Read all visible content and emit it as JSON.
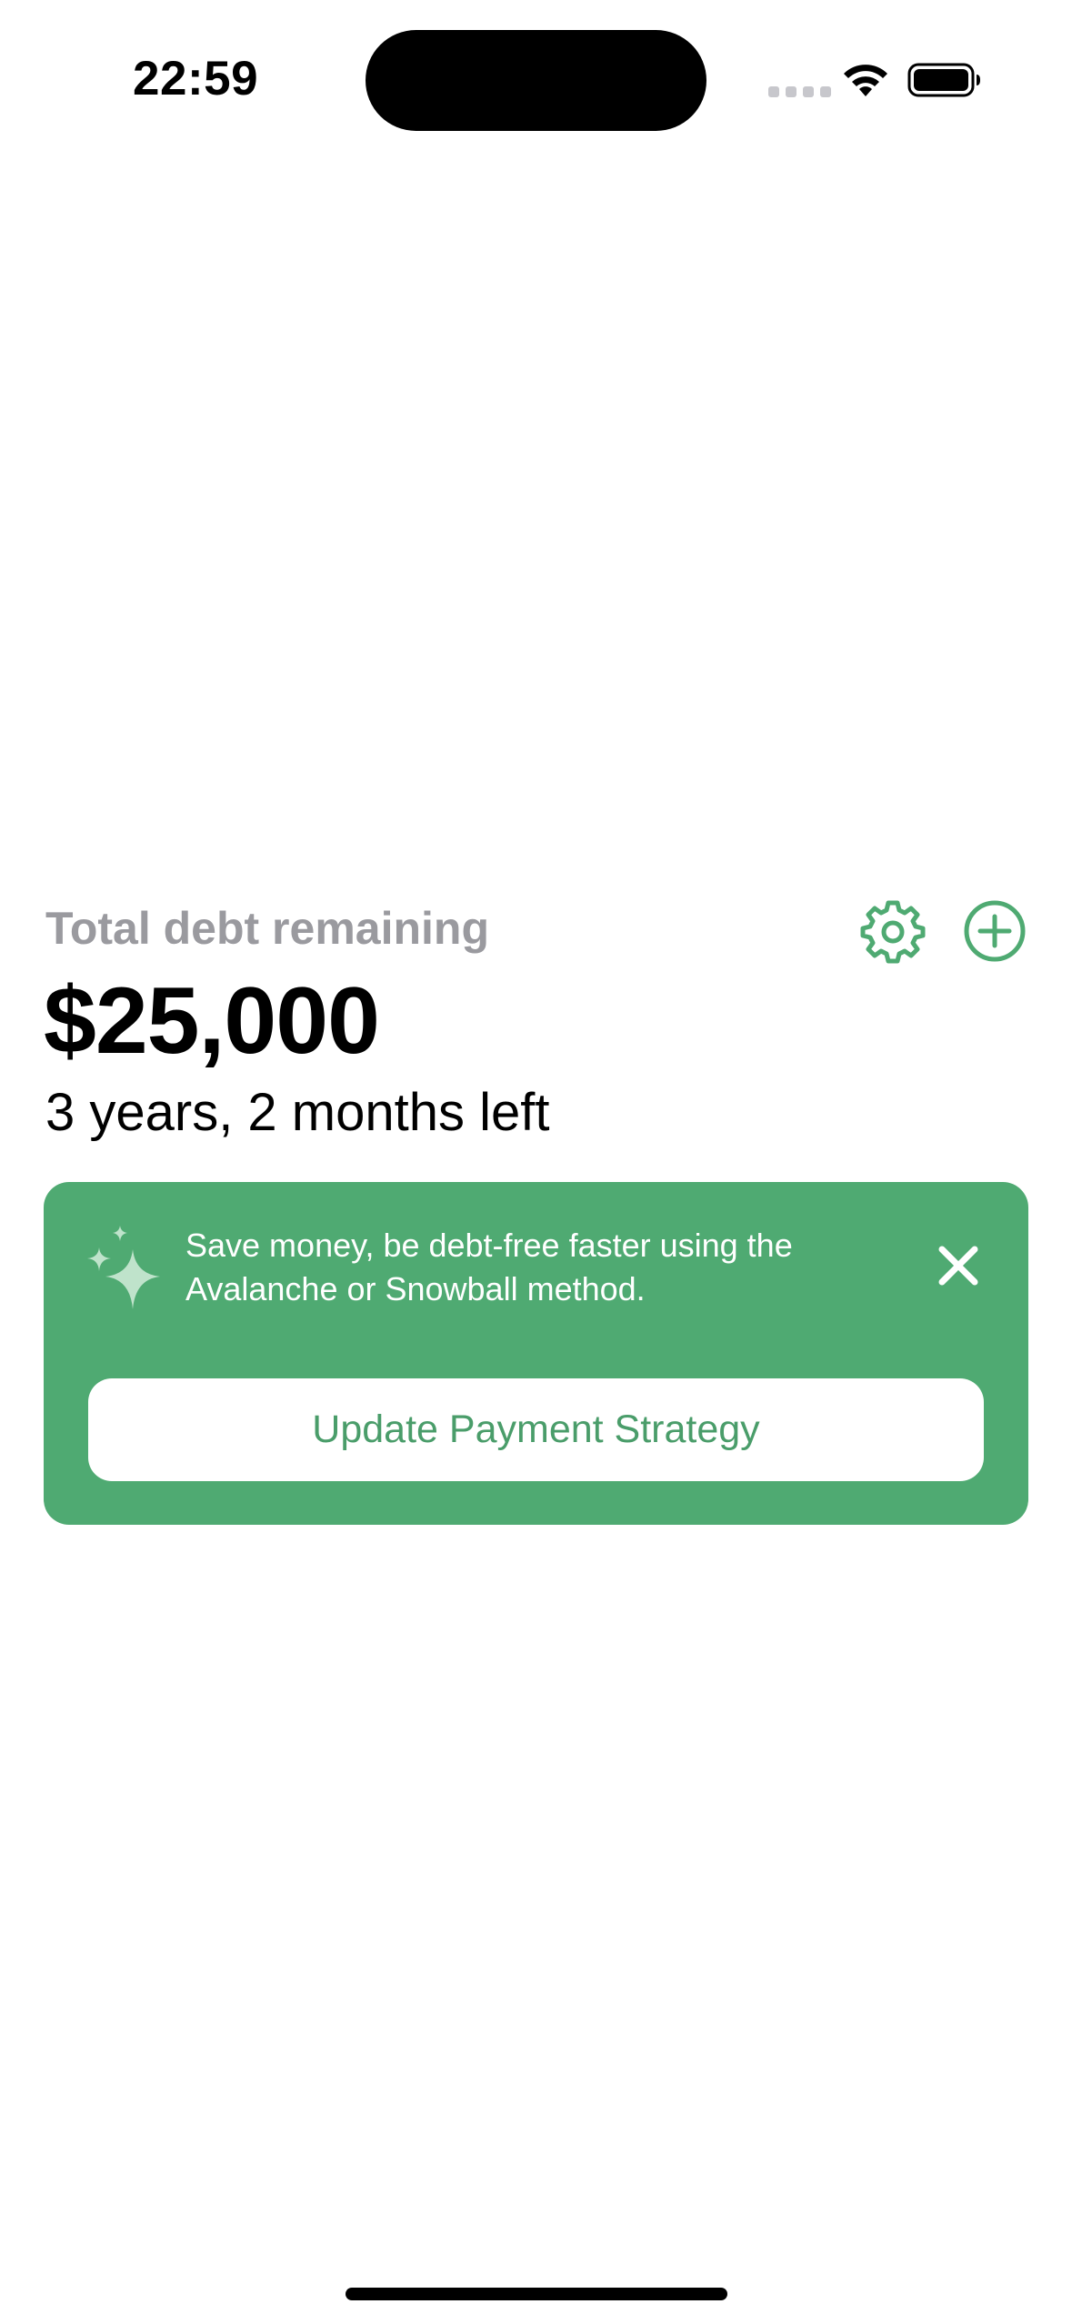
{
  "status_bar": {
    "time": "22:59",
    "icons": [
      "cellular-signal-icon",
      "wifi-icon",
      "battery-icon"
    ]
  },
  "header": {
    "label": "Total debt remaining",
    "settings_icon": "gear-icon",
    "add_icon": "plus-circle-icon"
  },
  "summary": {
    "total_amount": "$25,000",
    "time_left": "3 years, 2 months left"
  },
  "promo": {
    "icon": "sparkle-icon",
    "text_line_1": "Save money, be debt-free faster using the",
    "text_line_2": "Avalanche or Snowball method.",
    "close_icon": "close-icon",
    "button_label": "Update Payment Strategy"
  },
  "colors": {
    "accent": "#4faa72",
    "accent_text": "#4a9d6a",
    "label_gray": "#9a9a9f",
    "sparkle": "#bfe3cb"
  }
}
